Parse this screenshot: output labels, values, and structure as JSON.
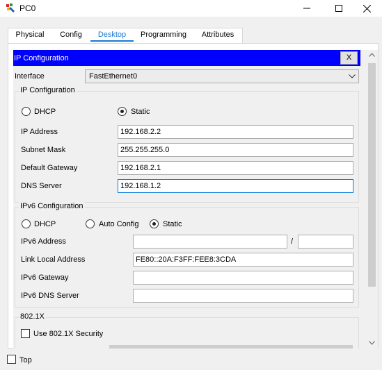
{
  "window": {
    "title": "PC0"
  },
  "tabs": [
    "Physical",
    "Config",
    "Desktop",
    "Programming",
    "Attributes"
  ],
  "panel": {
    "title": "IP Configuration",
    "close_label": "X",
    "interface_label": "Interface",
    "interface_value": "FastEthernet0",
    "ipv4": {
      "group_label": "IP Configuration",
      "dhcp_label": "DHCP",
      "static_label": "Static",
      "mode": "Static",
      "ip_label": "IP Address",
      "ip_value": "192.168.2.2",
      "mask_label": "Subnet Mask",
      "mask_value": "255.255.255.0",
      "gateway_label": "Default Gateway",
      "gateway_value": "192.168.2.1",
      "dns_label": "DNS Server",
      "dns_value": "192.168.1.2"
    },
    "ipv6": {
      "group_label": "IPv6 Configuration",
      "dhcp_label": "DHCP",
      "auto_label": "Auto Config",
      "static_label": "Static",
      "mode": "Static",
      "address_label": "IPv6 Address",
      "address_value": "",
      "prefix_sep": "/",
      "prefix_value": "",
      "link_local_label": "Link Local Address",
      "link_local_value": "FE80::20A:F3FF:FEE8:3CDA",
      "gateway_label": "IPv6 Gateway",
      "gateway_value": "",
      "dns_label": "IPv6 DNS Server",
      "dns_value": ""
    },
    "dot1x": {
      "group_label": "802.1X",
      "use_label": "Use 802.1X Security",
      "checked": false
    }
  },
  "bottom": {
    "top_label": "Top",
    "top_checked": false
  },
  "colors": {
    "panel_title_bg": "#0000fe",
    "active_tab": "#1a77d2",
    "focus_border": "#0078d7"
  }
}
